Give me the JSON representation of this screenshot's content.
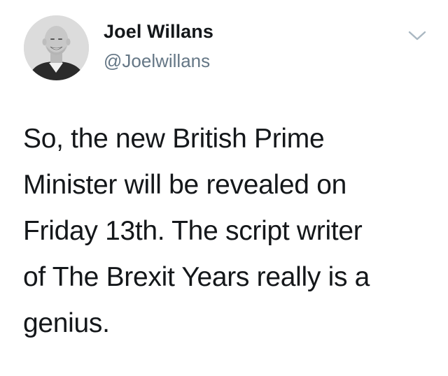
{
  "tweet": {
    "author": {
      "display_name": "Joel Willans",
      "handle": "@Joelwillans",
      "avatar_icon": "profile-photo"
    },
    "menu_icon": "chevron-down-icon",
    "text_lines": [
      "So, the new British Prime",
      "Minister will be revealed on",
      "Friday 13th. The script writer",
      "of The Brexit Years really is a",
      "genius."
    ]
  },
  "colors": {
    "text": "#14171a",
    "handle": "#657786",
    "chevron": "#aab8c2",
    "background": "#ffffff"
  }
}
